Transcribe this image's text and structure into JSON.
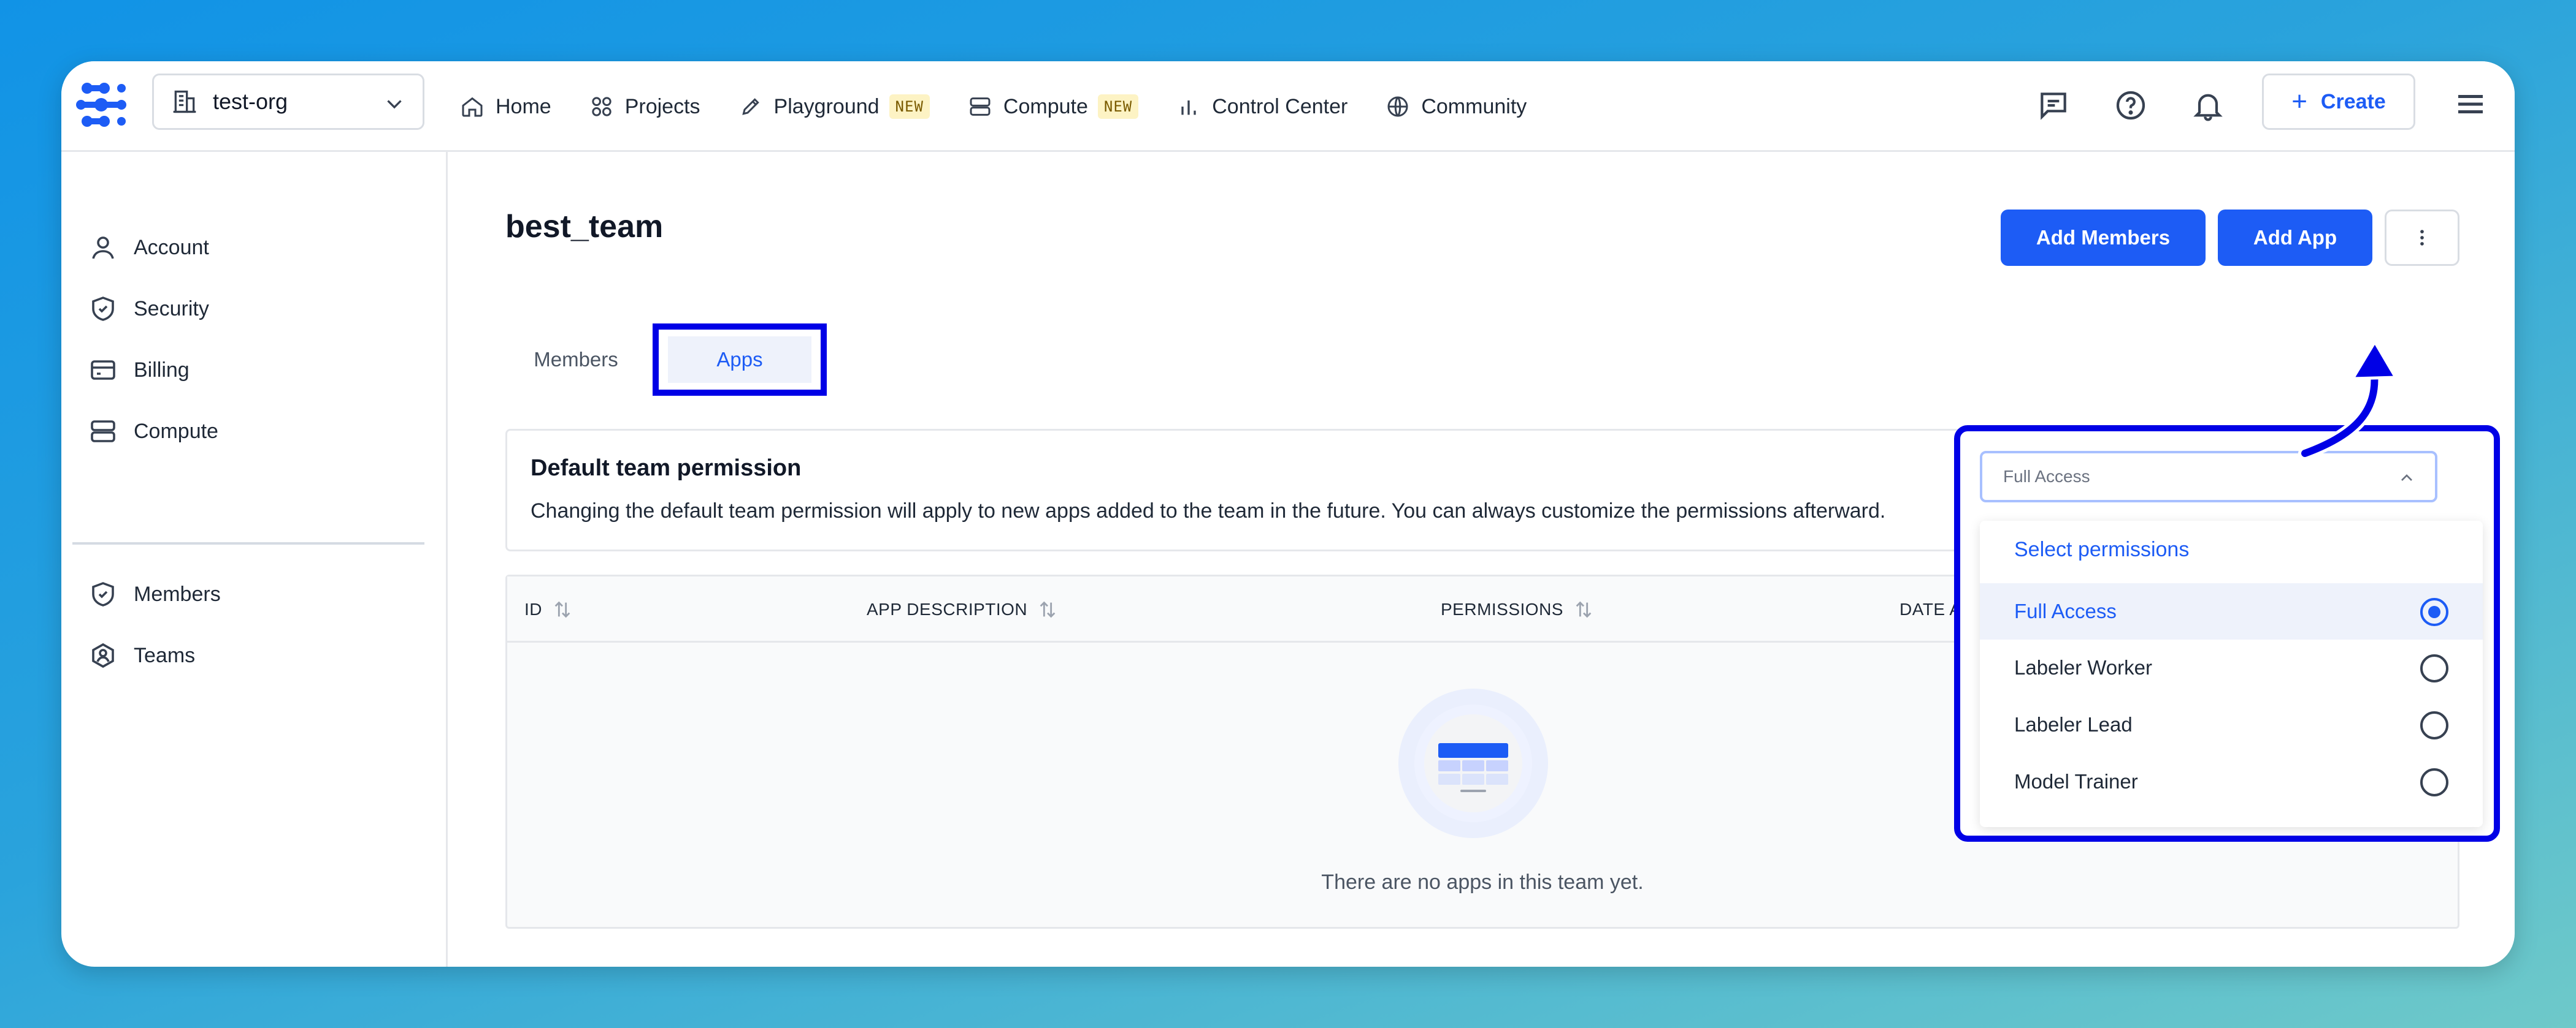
{
  "topbar": {
    "org": "test-org",
    "nav": [
      {
        "label": "Home",
        "icon": "home-icon"
      },
      {
        "label": "Projects",
        "icon": "projects-icon"
      },
      {
        "label": "Playground",
        "icon": "playground-icon",
        "badge": "NEW"
      },
      {
        "label": "Compute",
        "icon": "compute-icon",
        "badge": "NEW"
      },
      {
        "label": "Control Center",
        "icon": "chart-icon"
      },
      {
        "label": "Community",
        "icon": "globe-icon"
      }
    ],
    "create_label": "Create",
    "create_plus": "+"
  },
  "sidebar": {
    "items": [
      {
        "label": "Account",
        "icon": "user-icon"
      },
      {
        "label": "Security",
        "icon": "shield-icon"
      },
      {
        "label": "Billing",
        "icon": "card-icon"
      },
      {
        "label": "Compute",
        "icon": "server-icon"
      },
      {
        "label": "Members",
        "icon": "shield-check-icon"
      },
      {
        "label": "Teams",
        "icon": "teams-icon"
      }
    ]
  },
  "main": {
    "title": "best_team",
    "add_members_label": "Add Members",
    "add_app_label": "Add App",
    "tabs": [
      {
        "label": "Members",
        "active": false
      },
      {
        "label": "Apps",
        "active": true
      }
    ],
    "permission_card": {
      "title": "Default team permission",
      "description": "Changing the default team permission will apply to new apps added to the team in the future. You can always customize the permissions afterward."
    },
    "table": {
      "columns": [
        "ID",
        "APP DESCRIPTION",
        "PERMISSIONS",
        "DATE AS"
      ],
      "empty_text": "There are no apps in this team yet."
    }
  },
  "dropdown": {
    "value": "Full Access",
    "header": "Select permissions",
    "options": [
      {
        "label": "Full Access",
        "selected": true
      },
      {
        "label": "Labeler Worker",
        "selected": false
      },
      {
        "label": "Labeler Lead",
        "selected": false
      },
      {
        "label": "Model Trainer",
        "selected": false
      }
    ]
  },
  "colors": {
    "accent": "#1d5cf5",
    "highlight": "#0000e6"
  }
}
